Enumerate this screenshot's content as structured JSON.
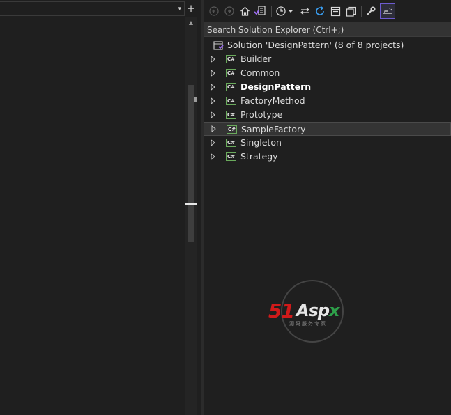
{
  "solution_explorer": {
    "search_placeholder": "Search Solution Explorer (Ctrl+;)",
    "solution_label": "Solution 'DesignPattern' (8 of 8 projects)",
    "projects": [
      {
        "label": "Builder",
        "startup": false,
        "selected": false
      },
      {
        "label": "Common",
        "startup": false,
        "selected": false
      },
      {
        "label": "DesignPattern",
        "startup": true,
        "selected": false
      },
      {
        "label": "FactoryMethod",
        "startup": false,
        "selected": false
      },
      {
        "label": "Prototype",
        "startup": false,
        "selected": false
      },
      {
        "label": "SampleFactory",
        "startup": false,
        "selected": true
      },
      {
        "label": "Singleton",
        "startup": false,
        "selected": false
      },
      {
        "label": "Strategy",
        "startup": false,
        "selected": false
      }
    ],
    "project_icon_text": "C#"
  },
  "editor": {
    "split_icon": "+",
    "dropdown_icon": "▾",
    "scroll_up_icon": "▲"
  },
  "watermark": {
    "brand_51": "51",
    "brand_asp": "Asp",
    "brand_x": "x",
    "subtitle": "源码服务专家"
  },
  "colors": {
    "background": "#1f1f1f",
    "accent_purple": "#6d5bd0",
    "csharp_green": "#6aaa5c",
    "refresh_blue": "#3a9ff2",
    "watermark_red": "#d01a1a"
  }
}
